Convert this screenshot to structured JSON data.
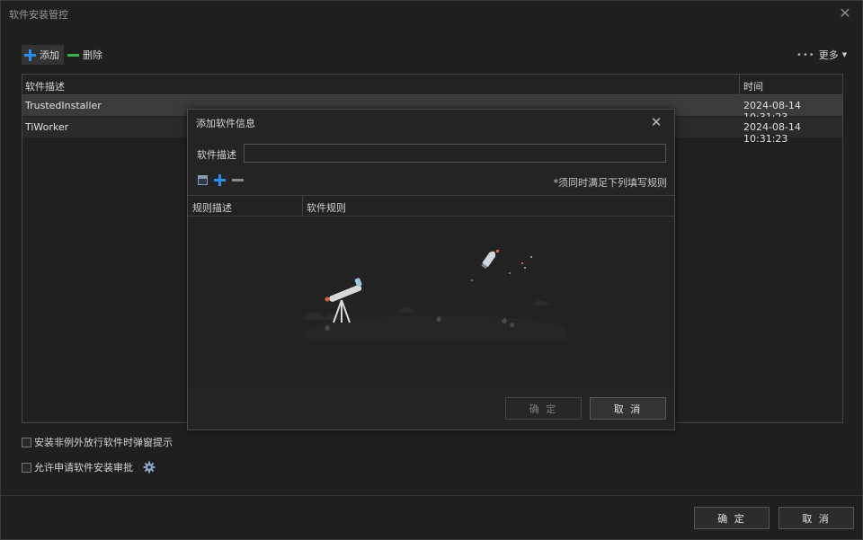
{
  "window": {
    "title": "软件安装管控"
  },
  "toolbar": {
    "add_label": "添加",
    "delete_label": "删除",
    "more_label": "更多"
  },
  "table": {
    "headers": [
      "软件描述",
      "时间"
    ],
    "rows": [
      {
        "name": "TrustedInstaller",
        "time": "2024-08-14 10:31:23"
      },
      {
        "name": "TiWorker",
        "time": "2024-08-14 10:31:23"
      }
    ]
  },
  "options": {
    "popup_label": "安装非例外放行软件时弹窗提示",
    "approval_label": "允许申请软件安装审批"
  },
  "footer": {
    "ok_label": "确 定",
    "cancel_label": "取 消"
  },
  "dialog": {
    "title": "添加软件信息",
    "desc_label": "软件描述",
    "desc_value": "",
    "note": "*须同时满足下列填写规则",
    "headers": [
      "规则描述",
      "软件规则"
    ],
    "ok_label": "确 定",
    "cancel_label": "取 消"
  },
  "colors": {
    "accent_blue": "#2d8cf0",
    "accent_green": "#37b24d",
    "background": "#1f1f1f"
  }
}
